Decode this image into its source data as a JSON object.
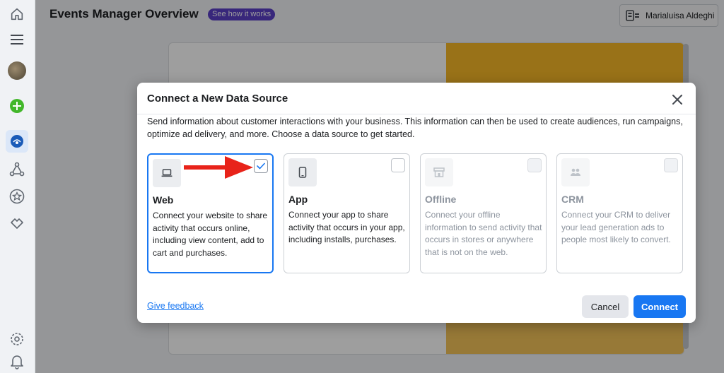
{
  "header": {
    "title": "Events Manager Overview",
    "how_it_works": "See how it works",
    "account_name": "Marialuisa Aldeghi"
  },
  "rail": {
    "icons": [
      "home-icon",
      "menu-icon",
      "avatar",
      "create-icon",
      "events-manager-icon",
      "connections-icon",
      "star-icon",
      "partner-icon",
      "settings-icon",
      "notifications-icon"
    ]
  },
  "modal": {
    "title": "Connect a New Data Source",
    "description": "Send information about customer interactions with your business. This information can then be used to create audiences, run campaigns, optimize ad delivery, and more. Choose a data source to get started.",
    "options": [
      {
        "name": "Web",
        "description": "Connect your website to share activity that occurs online, including view content, add to cart and purchases.",
        "selected": true,
        "disabled": false,
        "icon": "laptop-icon"
      },
      {
        "name": "App",
        "description": "Connect your app to share activity that occurs in your app, including installs, purchases.",
        "selected": false,
        "disabled": false,
        "icon": "phone-icon"
      },
      {
        "name": "Offline",
        "description": "Connect your offline information to send activity that occurs in stores or anywhere that is not on the web.",
        "selected": false,
        "disabled": true,
        "icon": "store-icon"
      },
      {
        "name": "CRM",
        "description": "Connect your CRM to deliver your lead generation ads to people most likely to convert.",
        "selected": false,
        "disabled": true,
        "icon": "people-icon"
      }
    ],
    "feedback_link": "Give feedback",
    "cancel_label": "Cancel",
    "connect_label": "Connect"
  },
  "colors": {
    "accent": "#1877f2",
    "pill": "#5b3fc7",
    "annotation_arrow": "#e8231a"
  }
}
